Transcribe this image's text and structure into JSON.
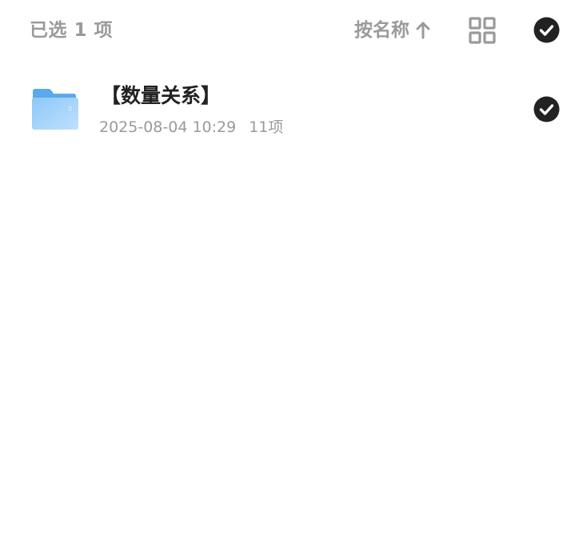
{
  "header": {
    "selected_count": "已选 1 项",
    "sort_label": "按名称",
    "sort_icon": "arrow-up-icon",
    "view_toggle_icon": "grid-view-icon",
    "select_all_icon": "check-circle-icon",
    "select_all_checked": true
  },
  "files": [
    {
      "name": "【数量关系】",
      "date": "2025-08-04 10:29",
      "count": "11项",
      "icon": "folder-icon",
      "checked": true
    }
  ],
  "colors": {
    "text_primary": "#222222",
    "text_secondary": "#9a9a9a",
    "checked_fill": "#222222",
    "folder_blue": "#6bb6f5",
    "background": "#ffffff"
  }
}
